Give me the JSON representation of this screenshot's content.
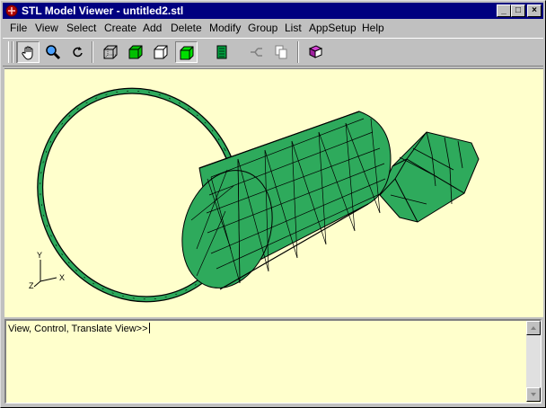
{
  "window": {
    "title": "STL Model Viewer - untitled2.stl",
    "controls": {
      "minimize": "_",
      "maximize": "□",
      "close": "×"
    }
  },
  "menu": [
    "File",
    "View",
    "Select",
    "Create",
    "Add",
    "Delete",
    "Modify",
    "Group",
    "List",
    "AppSetup",
    "Help"
  ],
  "toolbar": {
    "tools": [
      "hand-pan-icon",
      "zoom-magnifier-icon",
      "rotate-icon",
      "wireframe-cube-icon",
      "shaded-cube-icon",
      "hidden-line-cube-icon",
      "solid-green-cube-icon",
      "facet-list-icon",
      "assembly-icon",
      "copy-icon",
      "help-book-icon"
    ],
    "pressed": [
      "hand-pan-icon",
      "solid-green-cube-icon"
    ]
  },
  "viewport": {
    "axes": {
      "x": "X",
      "y": "Y",
      "z": "Z"
    },
    "colors": {
      "background": "#ffffcc",
      "mesh_fill": "#2eaa5c",
      "mesh_edge": "#000000"
    }
  },
  "console": {
    "prompt": "View, Control, Translate View>>"
  }
}
